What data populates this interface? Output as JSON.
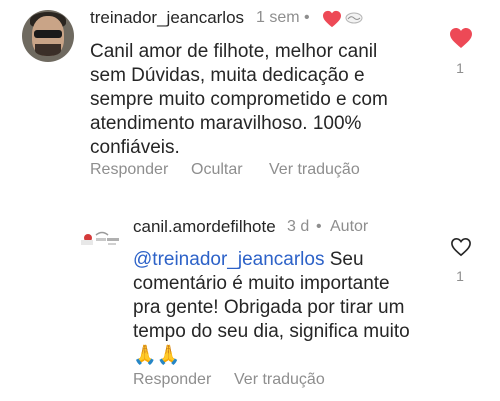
{
  "comment": {
    "username": "treinador_jeancarlos",
    "time": "1 sem",
    "lines": [
      "Canil amor de filhote, melhor canil",
      "sem Dúvidas, muita dedicação e",
      "sempre muito comprometido e com",
      "atendimento maravilhoso. 100%",
      "confiáveis."
    ],
    "actions": [
      "Responder",
      "Ocultar",
      "Ver tradução"
    ],
    "like_count": "1",
    "liked_color": "#ed4956"
  },
  "reply": {
    "username": "canil.amordefilhote",
    "time": "3 d",
    "author_label": "Autor",
    "mention": "@treinador_jeancarlos",
    "lines": [
      "Seu",
      "comentário é muito importante",
      "pra gente! Obrigada por tirar um",
      "tempo do seu dia, significa muito",
      "🙏🙏"
    ],
    "actions": [
      "Responder",
      "Ver tradução"
    ],
    "like_count": "1",
    "link_color": "#2d62c8"
  }
}
